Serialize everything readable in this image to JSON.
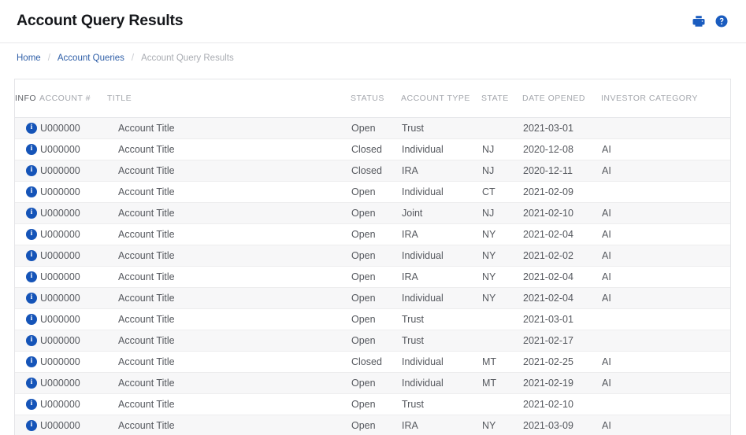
{
  "header": {
    "title": "Account Query Results",
    "actions": [
      {
        "name": "print-icon",
        "label": "Print"
      },
      {
        "name": "help-icon",
        "label": "Help"
      }
    ],
    "accent_color": "#1a5cbf"
  },
  "breadcrumb": {
    "items": [
      {
        "label": "Home",
        "current": false
      },
      {
        "label": "Account Queries",
        "current": false
      },
      {
        "label": "Account Query Results",
        "current": true
      }
    ],
    "separator": "/",
    "link_color": "#2f5fa8",
    "current_color": "#a9acb2"
  },
  "table": {
    "columns": [
      {
        "key": "info",
        "label": "INFO"
      },
      {
        "key": "account",
        "label": "ACCOUNT #"
      },
      {
        "key": "title",
        "label": "TITLE"
      },
      {
        "key": "status",
        "label": "STATUS"
      },
      {
        "key": "account_type",
        "label": "ACCOUNT TYPE"
      },
      {
        "key": "state",
        "label": "STATE"
      },
      {
        "key": "date_opened",
        "label": "DATE OPENED"
      },
      {
        "key": "investor_category",
        "label": "INVESTOR CATEGORY"
      }
    ],
    "info_icon_glyph": "i",
    "info_icon_color": "#1554b8",
    "rows": [
      {
        "account": "U000000",
        "title": "Account Title",
        "status": "Open",
        "account_type": "Trust",
        "state": "",
        "date_opened": "2021-03-01",
        "investor_category": ""
      },
      {
        "account": "U000000",
        "title": "Account Title",
        "status": "Closed",
        "account_type": "Individual",
        "state": "NJ",
        "date_opened": "2020-12-08",
        "investor_category": "AI"
      },
      {
        "account": "U000000",
        "title": "Account Title",
        "status": "Closed",
        "account_type": "IRA",
        "state": "NJ",
        "date_opened": "2020-12-11",
        "investor_category": "AI"
      },
      {
        "account": "U000000",
        "title": "Account Title",
        "status": "Open",
        "account_type": "Individual",
        "state": "CT",
        "date_opened": "2021-02-09",
        "investor_category": ""
      },
      {
        "account": "U000000",
        "title": "Account Title",
        "status": "Open",
        "account_type": "Joint",
        "state": "NJ",
        "date_opened": "2021-02-10",
        "investor_category": "AI"
      },
      {
        "account": "U000000",
        "title": "Account Title",
        "status": "Open",
        "account_type": "IRA",
        "state": "NY",
        "date_opened": "2021-02-04",
        "investor_category": "AI"
      },
      {
        "account": "U000000",
        "title": "Account Title",
        "status": "Open",
        "account_type": "Individual",
        "state": "NY",
        "date_opened": "2021-02-02",
        "investor_category": "AI"
      },
      {
        "account": "U000000",
        "title": "Account Title",
        "status": "Open",
        "account_type": "IRA",
        "state": "NY",
        "date_opened": "2021-02-04",
        "investor_category": "AI"
      },
      {
        "account": "U000000",
        "title": "Account Title",
        "status": "Open",
        "account_type": "Individual",
        "state": "NY",
        "date_opened": "2021-02-04",
        "investor_category": "AI"
      },
      {
        "account": "U000000",
        "title": "Account Title",
        "status": "Open",
        "account_type": "Trust",
        "state": "",
        "date_opened": "2021-03-01",
        "investor_category": ""
      },
      {
        "account": "U000000",
        "title": "Account Title",
        "status": "Open",
        "account_type": "Trust",
        "state": "",
        "date_opened": "2021-02-17",
        "investor_category": ""
      },
      {
        "account": "U000000",
        "title": "Account Title",
        "status": "Closed",
        "account_type": "Individual",
        "state": "MT",
        "date_opened": "2021-02-25",
        "investor_category": "AI"
      },
      {
        "account": "U000000",
        "title": "Account Title",
        "status": "Open",
        "account_type": "Individual",
        "state": "MT",
        "date_opened": "2021-02-19",
        "investor_category": "AI"
      },
      {
        "account": "U000000",
        "title": "Account Title",
        "status": "Open",
        "account_type": "Trust",
        "state": "",
        "date_opened": "2021-02-10",
        "investor_category": ""
      },
      {
        "account": "U000000",
        "title": "Account Title",
        "status": "Open",
        "account_type": "IRA",
        "state": "NY",
        "date_opened": "2021-03-09",
        "investor_category": "AI"
      }
    ]
  }
}
